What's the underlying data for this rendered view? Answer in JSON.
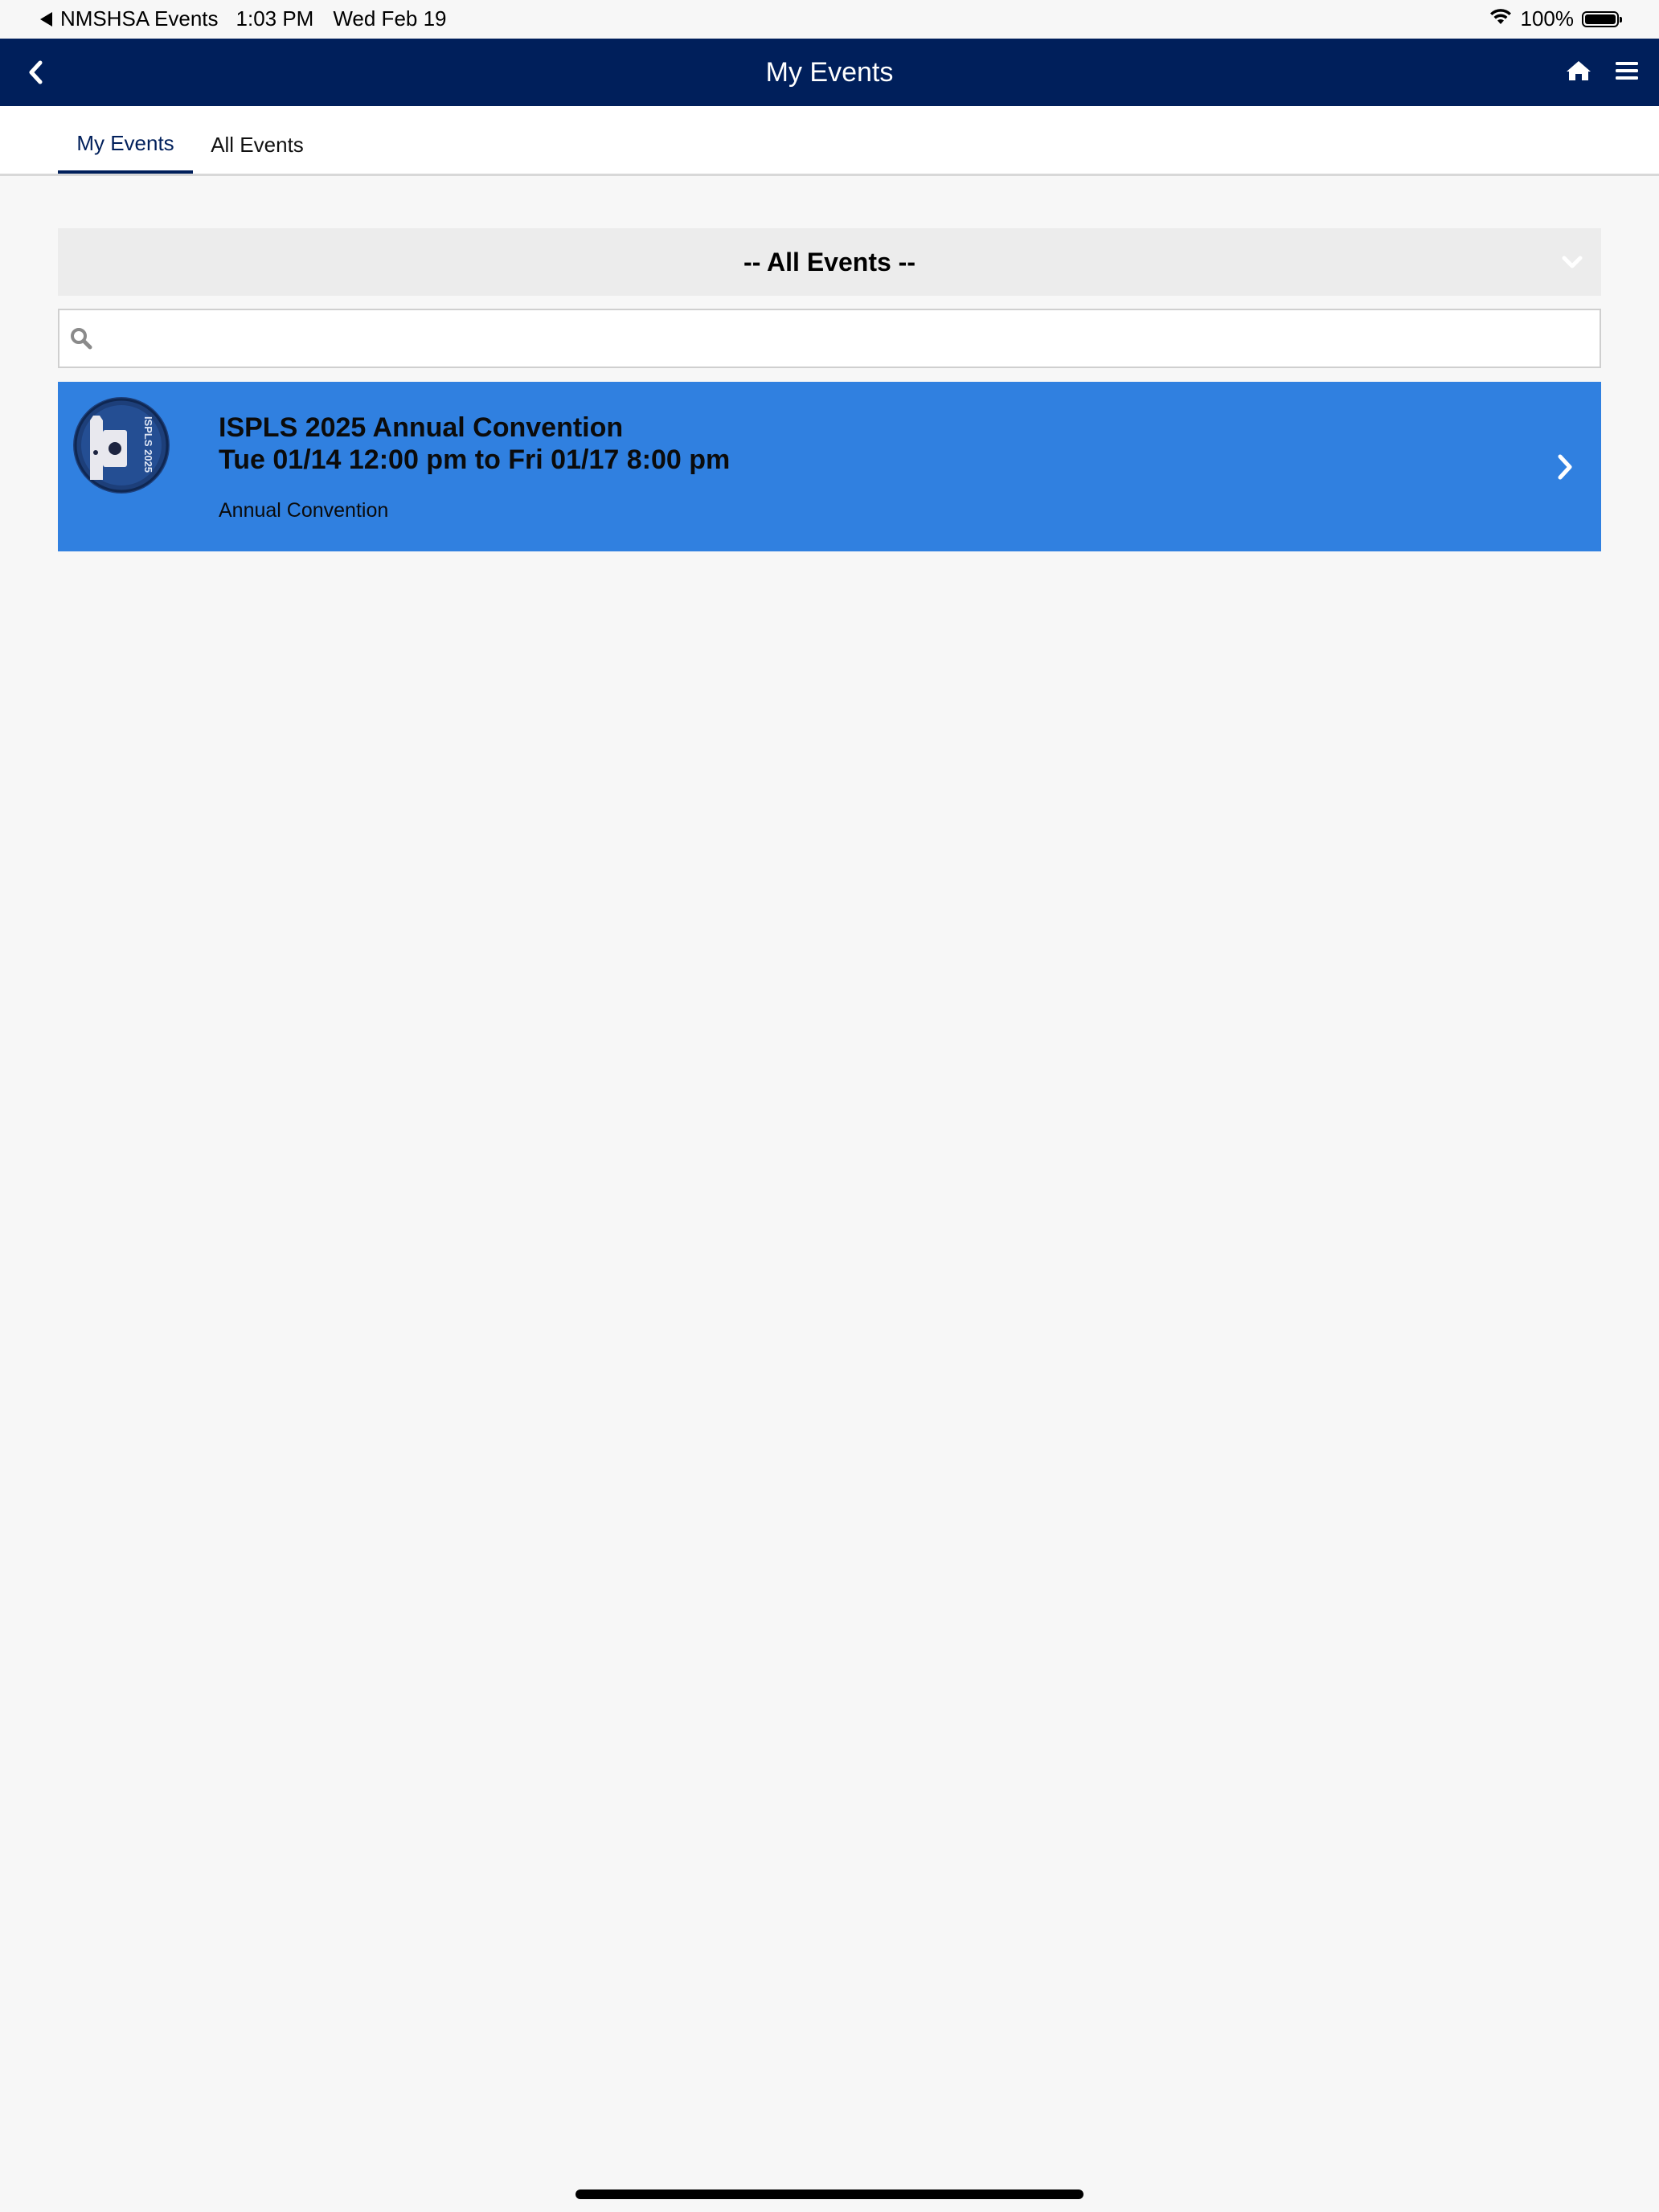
{
  "status_bar": {
    "back_app": "NMSHSA Events",
    "time": "1:03 PM",
    "date": "Wed Feb 19",
    "battery": "100%"
  },
  "navbar": {
    "title": "My Events",
    "back_icon": "chevron-left-icon",
    "home_icon": "home-icon",
    "menu_icon": "hamburger-menu-icon"
  },
  "tabs": [
    {
      "label": "My Events",
      "active": true
    },
    {
      "label": "All Events",
      "active": false
    }
  ],
  "filter": {
    "selected": "-- All Events --"
  },
  "search": {
    "value": "",
    "placeholder": ""
  },
  "events": [
    {
      "title": "ISPLS 2025 Annual Convention",
      "dates": "Tue 01/14 12:00 pm to Fri 01/17 8:00 pm",
      "type": "Annual Convention",
      "logo_text": "ISPLS 2025"
    }
  ],
  "colors": {
    "nav_bg": "#001f5b",
    "card_bg": "#3080e0",
    "page_bg": "#f7f7f7",
    "active_tab": "#001f5b"
  }
}
